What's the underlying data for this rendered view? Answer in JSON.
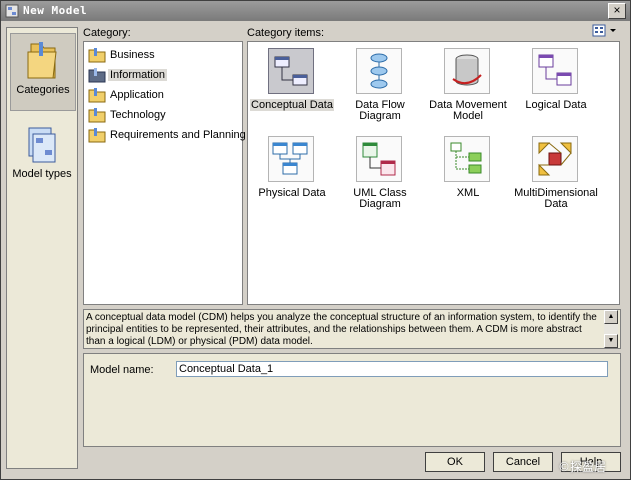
{
  "window": {
    "title": "New Model"
  },
  "nav": {
    "items": [
      {
        "label": "Categories",
        "selected": true
      },
      {
        "label": "Model types",
        "selected": false
      }
    ]
  },
  "category": {
    "label": "Category:",
    "items": [
      "Business",
      "Information",
      "Application",
      "Technology",
      "Requirements and Planning"
    ],
    "selected": "Information"
  },
  "category_items": {
    "label": "Category items:",
    "items": [
      "Conceptual Data",
      "Data Flow Diagram",
      "Data Movement Model",
      "Logical Data",
      "Physical Data",
      "UML Class Diagram",
      "XML",
      "MultiDimensional Data"
    ],
    "selected": "Conceptual Data"
  },
  "description": "A conceptual data model (CDM) helps you analyze the conceptual structure of an information system, to identify the principal entities to be represented, their attributes, and the relationships between them. A CDM is more abstract than a logical (LDM) or physical (PDM) data model.",
  "model": {
    "name_label": "Model name:",
    "name_value": "Conceptual Data_1"
  },
  "buttons": {
    "ok": "OK",
    "cancel": "Cancel",
    "help": "Help"
  },
  "watermark": "©探盈居"
}
